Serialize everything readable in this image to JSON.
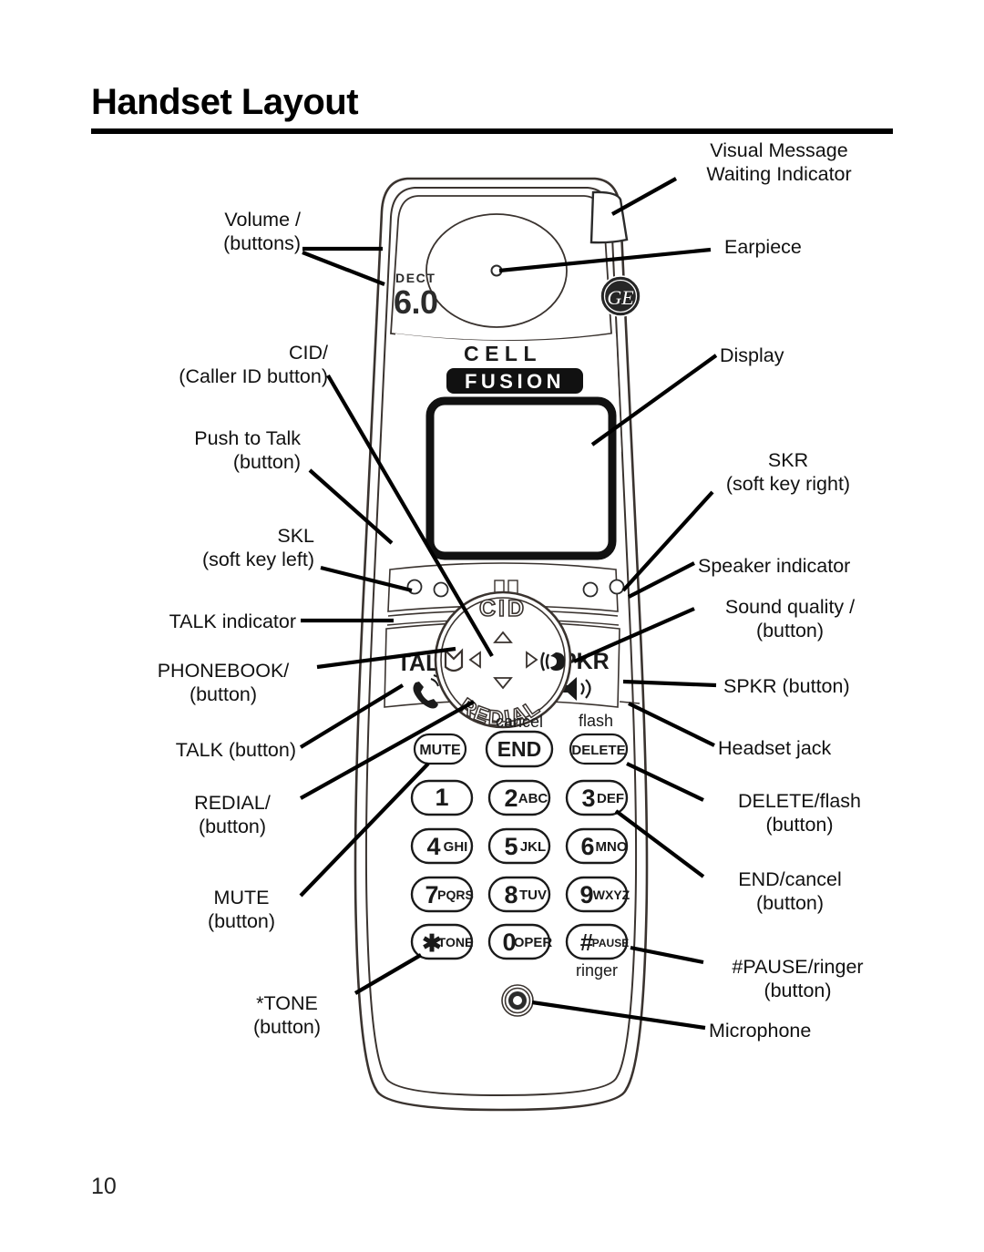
{
  "page": {
    "title": "Handset Layout",
    "number": "10"
  },
  "device": {
    "brand_badge": "GE",
    "dect_label": "DECT",
    "dect_version": "6.0",
    "model_line1": "CELL",
    "model_line2": "FUSION"
  },
  "navigation_ring": {
    "top_label": "CID",
    "bottom_label": "REDIAL",
    "up_icon": "triangle-up-icon",
    "down_icon": "triangle-down-icon",
    "left_icon": "triangle-left-icon",
    "right_icon": "triangle-right-icon",
    "phonebook_icon": "envelope-phonebook-icon",
    "sound_quality_icon": "sound-quality-icon"
  },
  "side_keys": {
    "talk_label": "TALK",
    "talk_icon": "handset-phone-icon",
    "spkr_label": "SPKR",
    "spkr_icon": "speaker-icon"
  },
  "function_keys": [
    {
      "label": "MUTE",
      "above": ""
    },
    {
      "label": "END",
      "above": "cancel"
    },
    {
      "label": "DELETE",
      "above": "flash"
    }
  ],
  "keypad": [
    {
      "digit": "1",
      "letters": "",
      "below": ""
    },
    {
      "digit": "2",
      "letters": "ABC",
      "below": ""
    },
    {
      "digit": "3",
      "letters": "DEF",
      "below": ""
    },
    {
      "digit": "4",
      "letters": "GHI",
      "below": ""
    },
    {
      "digit": "5",
      "letters": "JKL",
      "below": ""
    },
    {
      "digit": "6",
      "letters": "MNO",
      "below": ""
    },
    {
      "digit": "7",
      "letters": "PQRS",
      "below": ""
    },
    {
      "digit": "8",
      "letters": "TUV",
      "below": ""
    },
    {
      "digit": "9",
      "letters": "WXYZ",
      "below": ""
    },
    {
      "digit": "✱",
      "letters": "TONE",
      "below": ""
    },
    {
      "digit": "0",
      "letters": "OPER",
      "below": ""
    },
    {
      "digit": "#",
      "letters": "PAUSE",
      "below": "ringer"
    }
  ],
  "keypad_extra": {
    "ringer_label": "ringer"
  },
  "callouts_left": [
    {
      "id": "volume",
      "text": "Volume    /\n(buttons)"
    },
    {
      "id": "cid",
      "text": "CID/\n(Caller ID button)"
    },
    {
      "id": "push-to-talk",
      "text": "Push to Talk\n(button)"
    },
    {
      "id": "skl",
      "text": "SKL\n(soft key left)"
    },
    {
      "id": "talk-indicator",
      "text": "TALK indicator"
    },
    {
      "id": "phonebook",
      "text": "PHONEBOOK/\n(button)"
    },
    {
      "id": "talk-button",
      "text": "TALK (button)"
    },
    {
      "id": "redial",
      "text": "REDIAL/\n(button)"
    },
    {
      "id": "mute",
      "text": "MUTE\n(button)"
    },
    {
      "id": "tone",
      "text": "*TONE\n(button)"
    }
  ],
  "callouts_right": [
    {
      "id": "vmwi",
      "text": "Visual Message\nWaiting Indicator"
    },
    {
      "id": "earpiece",
      "text": "Earpiece"
    },
    {
      "id": "display",
      "text": "Display"
    },
    {
      "id": "skr",
      "text": "SKR\n(soft key right)"
    },
    {
      "id": "speaker-indicator",
      "text": "Speaker indicator"
    },
    {
      "id": "sound-quality",
      "text": "Sound quality /\n(button)"
    },
    {
      "id": "spkr-button",
      "text": "SPKR (button)"
    },
    {
      "id": "headset-jack",
      "text": "Headset jack"
    },
    {
      "id": "delete-flash",
      "text": "DELETE/flash\n(button)"
    },
    {
      "id": "end-cancel",
      "text": "END/cancel\n(button)"
    },
    {
      "id": "pause-ringer",
      "text": "#PAUSE/ringer\n(button)"
    },
    {
      "id": "microphone",
      "text": "Microphone"
    }
  ],
  "colors": {
    "ink": "#000000",
    "outline": "#3a332f",
    "badge": "#262626"
  }
}
